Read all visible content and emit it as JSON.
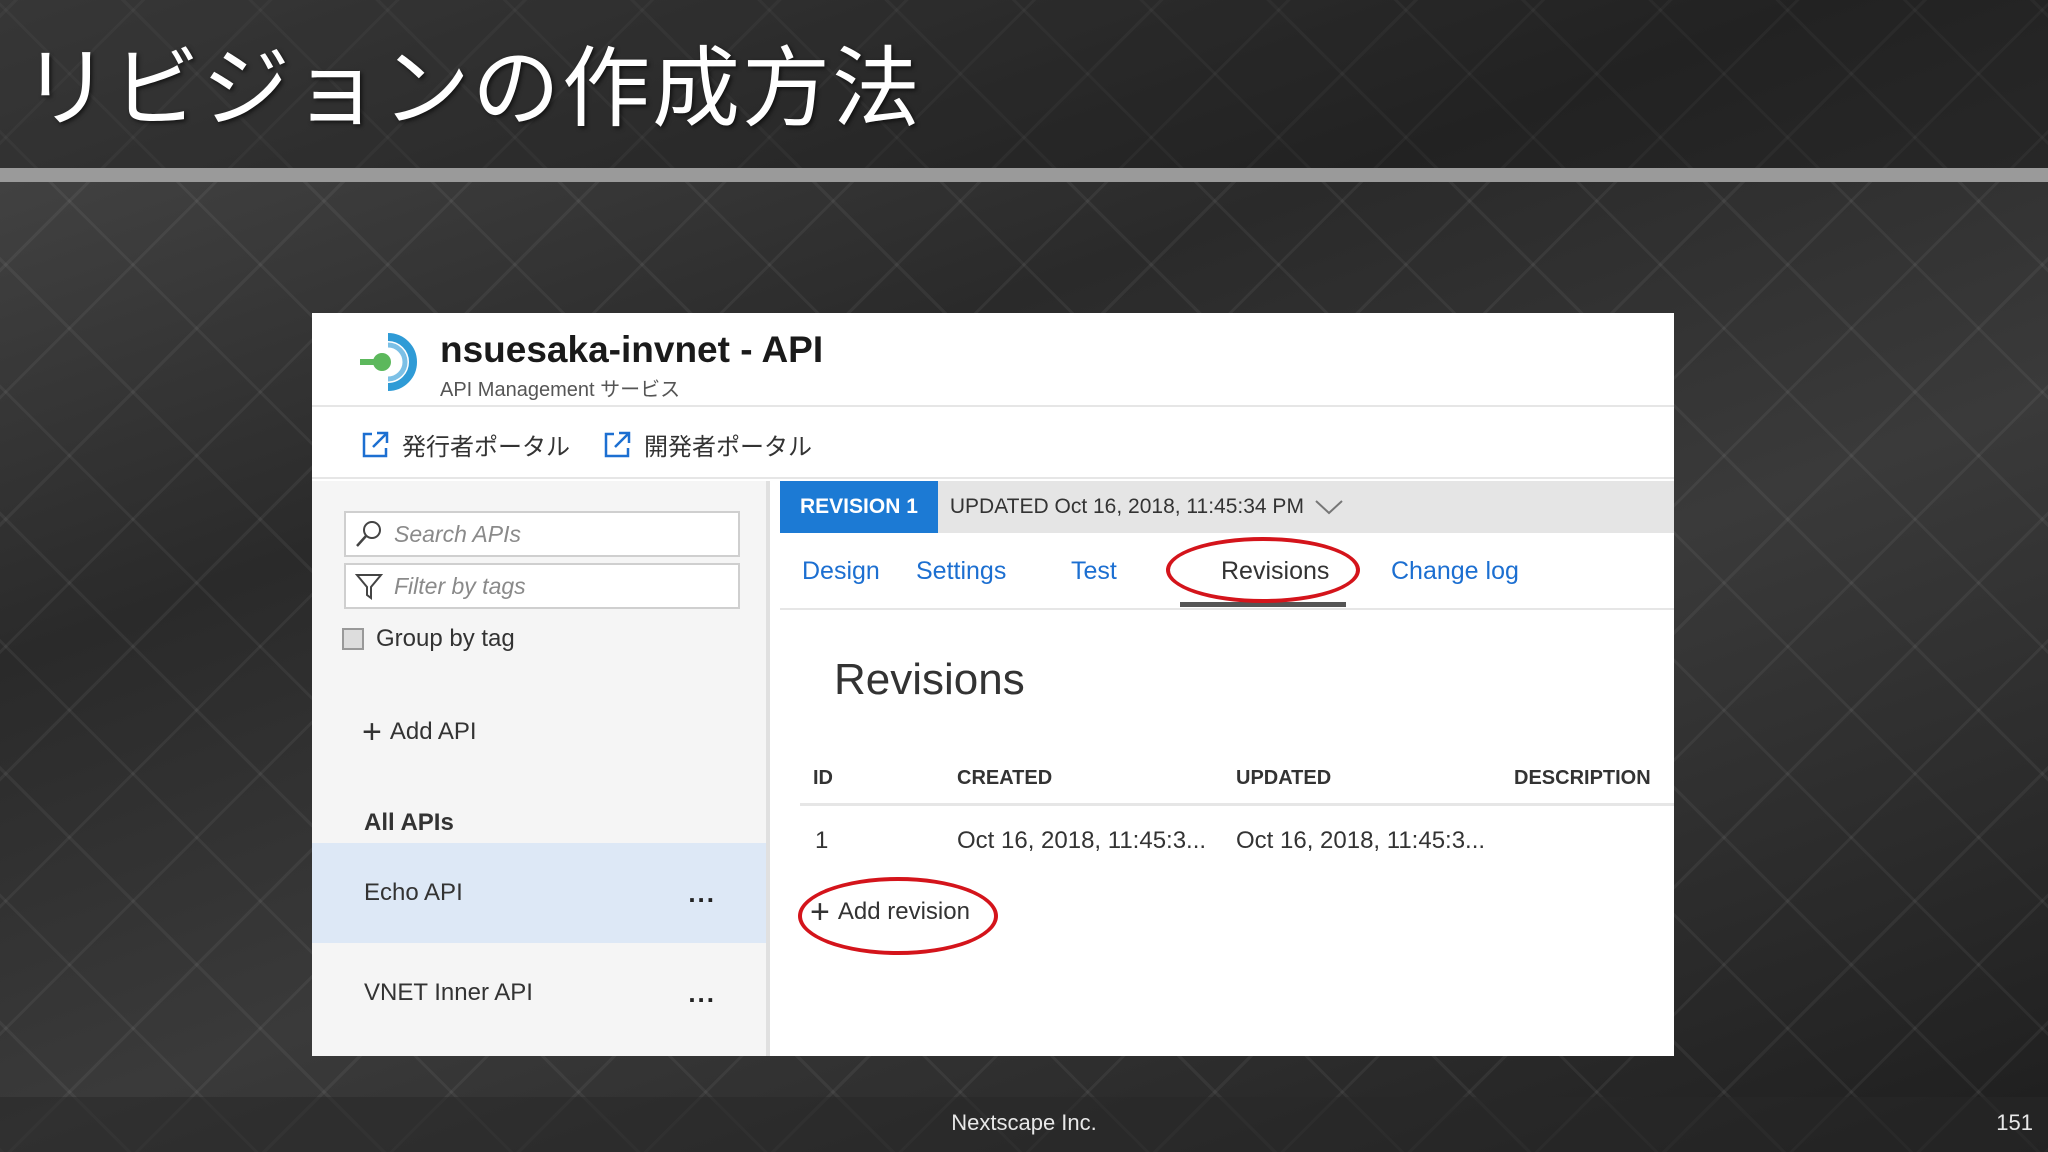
{
  "slide": {
    "title": "リビジョンの作成方法",
    "footer_company": "Nextscape Inc.",
    "page_number": "151"
  },
  "api_header": {
    "title": "nsuesaka-invnet - API",
    "subtitle": "API Management サービス"
  },
  "portal_links": [
    {
      "label": "発行者ポータル",
      "icon": "external-link-icon"
    },
    {
      "label": "開発者ポータル",
      "icon": "external-link-icon"
    }
  ],
  "sidebar": {
    "search_placeholder": "Search APIs",
    "filter_placeholder": "Filter by tags",
    "group_by_tag_label": "Group by tag",
    "group_by_tag_checked": false,
    "add_api_label": "Add API",
    "all_apis_heading": "All APIs",
    "items": [
      {
        "label": "Echo API",
        "more": "...",
        "selected": true
      },
      {
        "label": "VNET Inner API",
        "more": "...",
        "selected": false
      }
    ]
  },
  "revision_bar": {
    "badge": "REVISION 1",
    "updated": "UPDATED Oct 16, 2018, 11:45:34 PM"
  },
  "tabs": [
    {
      "label": "Design",
      "active": false
    },
    {
      "label": "Settings",
      "active": false
    },
    {
      "label": "Test",
      "active": false
    },
    {
      "label": "Revisions",
      "active": true
    },
    {
      "label": "Change log",
      "active": false
    }
  ],
  "revisions": {
    "heading": "Revisions",
    "columns": [
      "ID",
      "CREATED",
      "UPDATED",
      "DESCRIPTION"
    ],
    "rows": [
      {
        "id": "1",
        "created": "Oct 16, 2018, 11:45:3...",
        "updated": "Oct 16, 2018, 11:45:3...",
        "description": ""
      }
    ],
    "add_revision_label": "Add revision"
  },
  "colors": {
    "accent": "#1c7ad4",
    "highlight_circle": "#d4141b",
    "selected_row": "#dde8f6"
  }
}
